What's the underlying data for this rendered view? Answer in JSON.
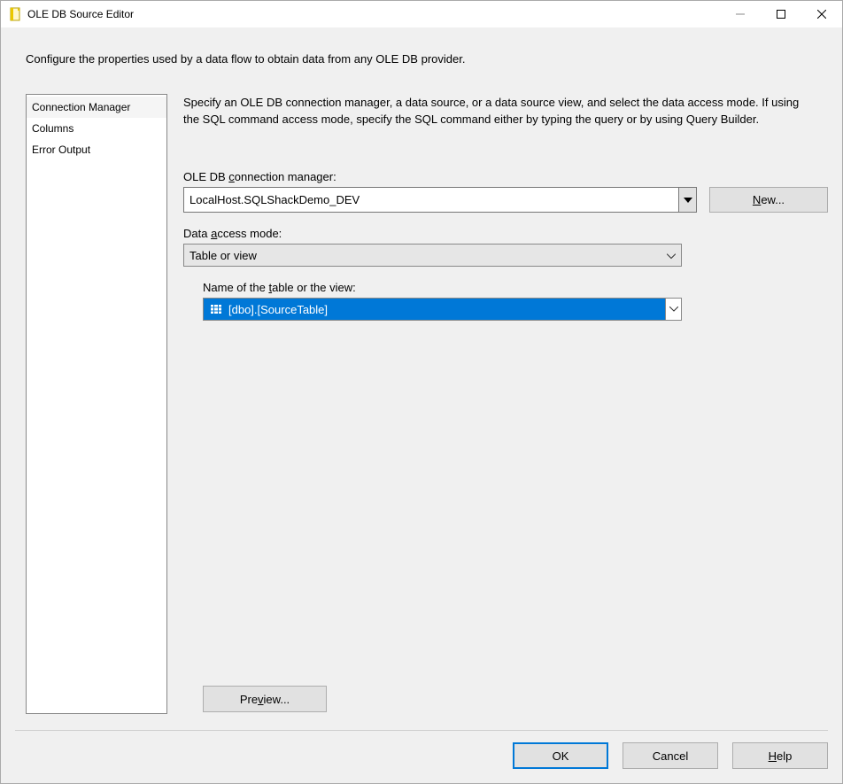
{
  "window": {
    "title": "OLE DB Source Editor"
  },
  "intro": "Configure the properties used by a data flow to obtain data from any OLE DB provider.",
  "sidebar": {
    "items": [
      {
        "label": "Connection Manager",
        "active": true
      },
      {
        "label": "Columns",
        "active": false
      },
      {
        "label": "Error Output",
        "active": false
      }
    ]
  },
  "main": {
    "description": "Specify an OLE DB connection manager, a data source, or a data source view, and select the data access mode. If using the SQL command access mode, specify the SQL command either by typing the query or by using Query Builder.",
    "cm_label_pre": "OLE DB ",
    "cm_label_accel": "c",
    "cm_label_post": "onnection manager:",
    "cm_value": "LocalHost.SQLShackDemo_DEV",
    "new_btn_pre": "",
    "new_btn_accel": "N",
    "new_btn_post": "ew...",
    "dam_label_pre": "Data ",
    "dam_label_accel": "a",
    "dam_label_post": "ccess mode:",
    "dam_value": "Table or view",
    "tbl_label_pre": "Name of the ",
    "tbl_label_accel": "t",
    "tbl_label_post": "able or the view:",
    "tbl_value": "[dbo].[SourceTable]",
    "preview_label_pre": "Pre",
    "preview_label_accel": "v",
    "preview_label_post": "iew..."
  },
  "footer": {
    "ok": "OK",
    "cancel": "Cancel",
    "help_accel": "H",
    "help_post": "elp"
  }
}
